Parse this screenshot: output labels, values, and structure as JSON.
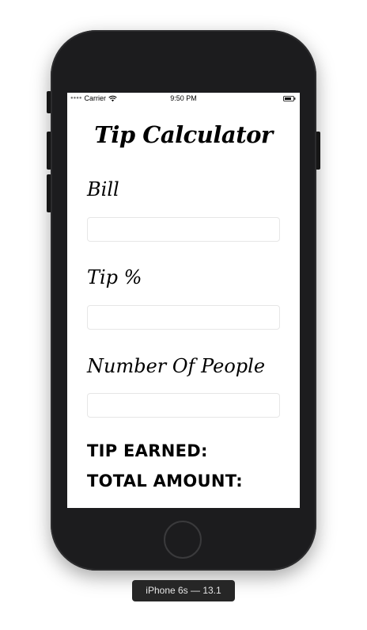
{
  "status_bar": {
    "carrier": "Carrier",
    "time": "9:50 PM",
    "signal_icon": "signal-dots-icon",
    "wifi_icon": "wifi-icon",
    "battery_icon": "battery-icon"
  },
  "app": {
    "title": "Tip Calculator",
    "fields": {
      "bill": {
        "label": "Bill",
        "value": "",
        "placeholder": ""
      },
      "tip": {
        "label": "Tip %",
        "value": "",
        "placeholder": ""
      },
      "people": {
        "label": "Number Of People",
        "value": "",
        "placeholder": ""
      }
    },
    "results": {
      "tip_earned_label": "TIP EARNED:",
      "total_amount_label": "TOTAL AMOUNT:"
    }
  },
  "device": {
    "caption": "iPhone 6s — 13.1"
  },
  "colors": {
    "device_body": "#1c1c1e",
    "screen_background": "#ffffff",
    "text": "#000000",
    "field_border": "#e6e6e6"
  }
}
